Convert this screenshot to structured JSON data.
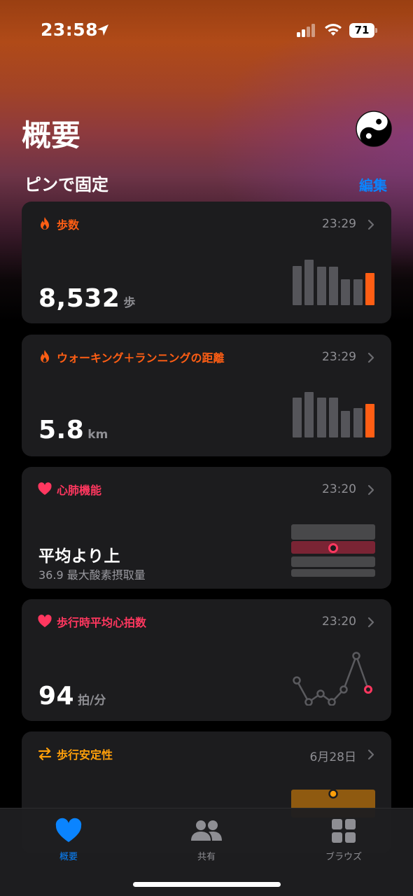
{
  "status": {
    "time": "23:58",
    "battery": "71",
    "icons": [
      "location-arrow-icon",
      "cellular-signal-icon",
      "wifi-icon",
      "battery-icon"
    ]
  },
  "header": {
    "title": "概要",
    "avatar_icon": "yin-yang-icon"
  },
  "pinned": {
    "title": "ピンで固定",
    "edit_label": "編集"
  },
  "cards": [
    {
      "label": "歩数",
      "time": "23:29",
      "value": "8,532",
      "unit": "歩",
      "icon": "flame-icon",
      "color": "#ff5e14",
      "bars": [
        0.85,
        0.98,
        0.83,
        0.83,
        0.56,
        0.56,
        0.69
      ]
    },
    {
      "label": "ウォーキング＋ランニングの距離",
      "time": "23:29",
      "value": "5.8",
      "unit": "km",
      "icon": "flame-icon",
      "color": "#ff5e14",
      "bars": [
        0.86,
        0.98,
        0.86,
        0.86,
        0.58,
        0.63,
        0.72
      ]
    },
    {
      "label": "心肺機能",
      "time": "23:20",
      "value": "平均より上",
      "sub": "36.9 最大酸素摂取量",
      "icon": "heart-icon",
      "color": "#ff375f"
    },
    {
      "label": "歩行時平均心拍数",
      "time": "23:20",
      "value": "94",
      "unit": "拍/分",
      "icon": "heart-icon",
      "color": "#ff375f"
    },
    {
      "label": "歩行安定性",
      "time": "6月28日",
      "icon": "arrows-swap-icon",
      "color": "#ff9f0a"
    }
  ],
  "tabs": [
    {
      "label": "概要",
      "icon": "heart-filled-icon",
      "active": true
    },
    {
      "label": "共有",
      "icon": "people-icon",
      "active": false
    },
    {
      "label": "ブラウズ",
      "icon": "grid-icon",
      "active": false
    }
  ],
  "colors": {
    "accent": "#0a84ff",
    "card_bg": "#1c1c1e",
    "vo2_highlight": "#7a2434",
    "stability": "#8f5a10"
  }
}
